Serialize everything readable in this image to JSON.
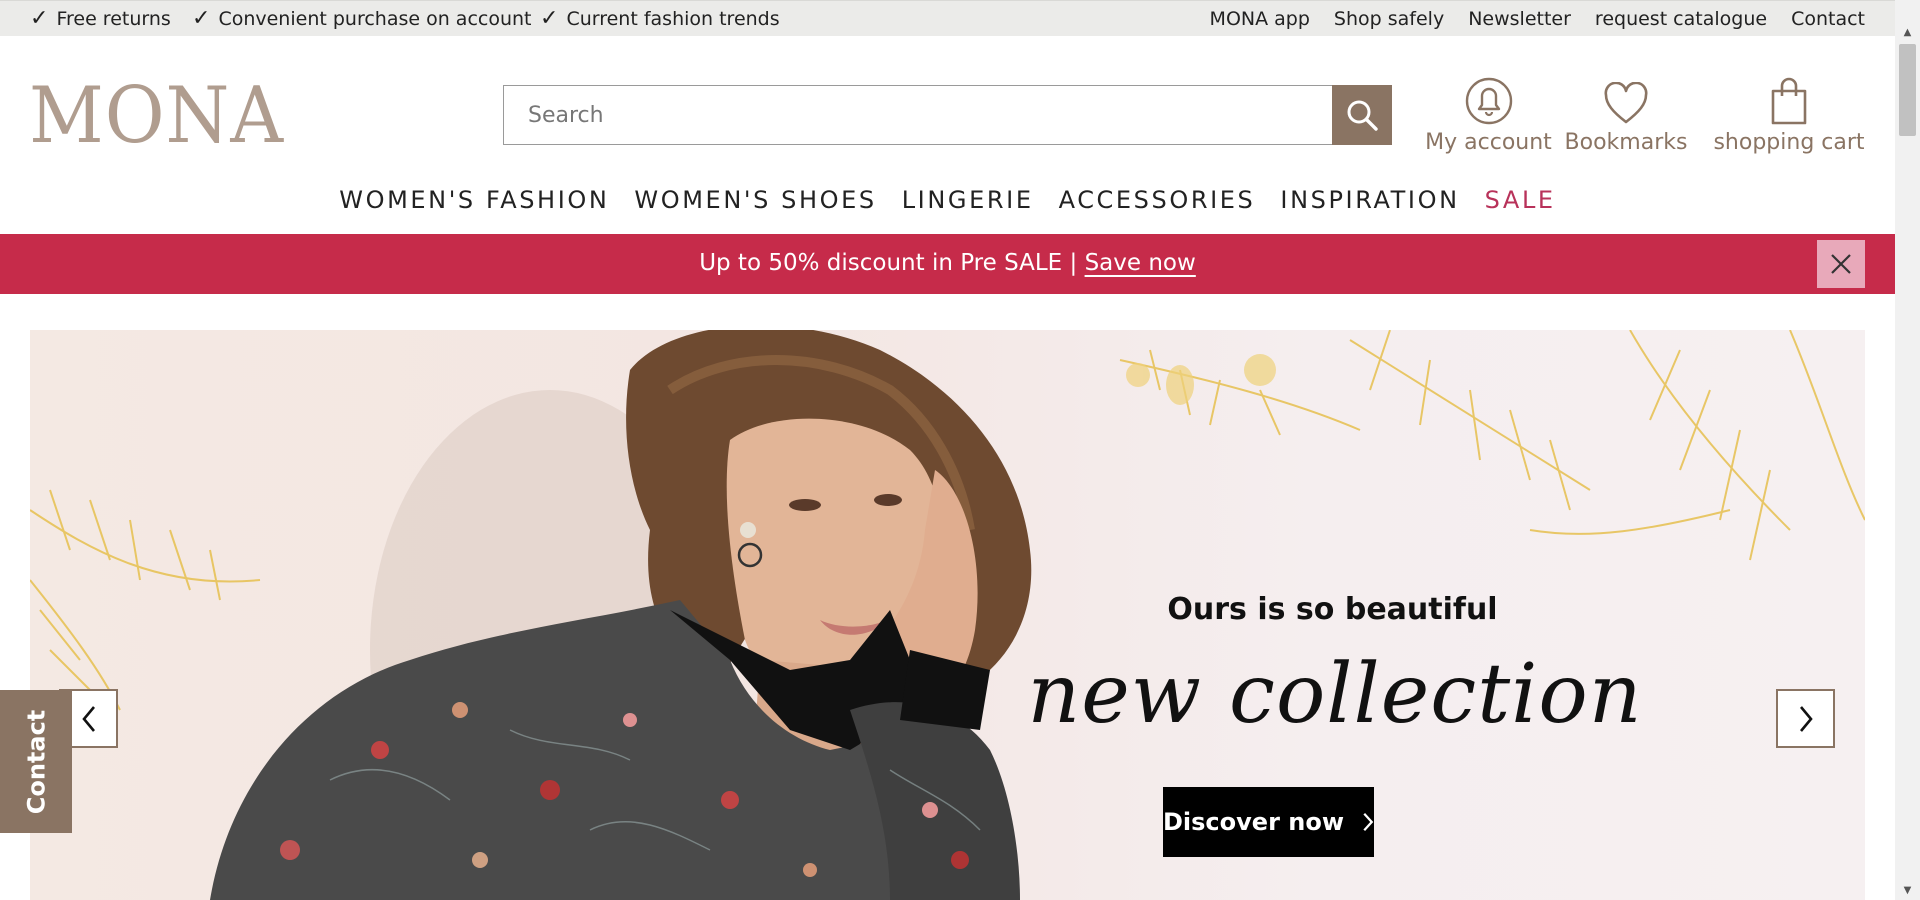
{
  "topbar": {
    "usps": [
      {
        "label": "Free returns"
      },
      {
        "label": "Convenient purchase on account"
      },
      {
        "label": "Current fashion trends"
      }
    ],
    "check_glyph": "✓",
    "links": [
      "MONA app",
      "Shop safely",
      "Newsletter",
      "request catalogue",
      "Contact"
    ]
  },
  "header": {
    "logo_text": "MONA",
    "search_placeholder": "Search",
    "icons": {
      "account": {
        "label": "My account",
        "icon": "bell-person-icon"
      },
      "bookmarks": {
        "label": "Bookmarks",
        "icon": "heart-icon"
      },
      "cart": {
        "label": "shopping cart",
        "icon": "shopping-bag-icon"
      }
    }
  },
  "nav": {
    "items": [
      "WOMEN'S FASHION",
      "WOMEN'S SHOES",
      "LINGERIE",
      "ACCESSORIES",
      "INSPIRATION",
      "SALE"
    ],
    "sale_color": "#b8325a"
  },
  "promo": {
    "text": "Up to 50% discount in Pre SALE |",
    "link": "Save now",
    "bg_color": "#c62b4a"
  },
  "hero": {
    "kicker": "Ours is so beautiful",
    "headline": "new collection",
    "cta": "Discover now"
  },
  "contact_tab": {
    "label": "Contact"
  },
  "colors": {
    "brand": "#8a7463",
    "logo": "#b09d8f",
    "topbar_bg": "#ebebe9"
  }
}
